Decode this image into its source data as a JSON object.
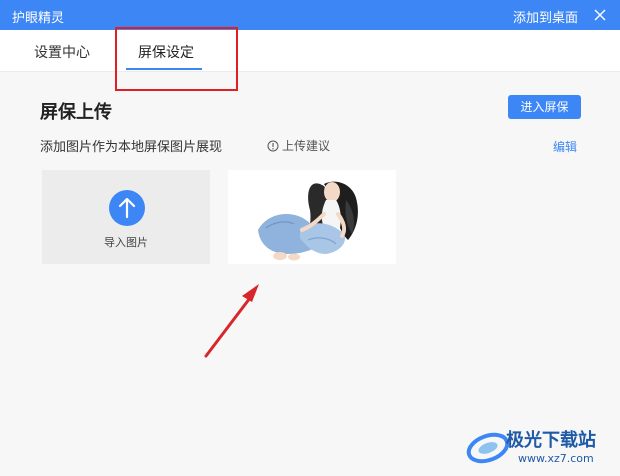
{
  "titlebar": {
    "app_title": "护眼精灵",
    "add_to_desktop": "添加到桌面",
    "close_icon": "close-icon"
  },
  "tabs": [
    {
      "label": "设置中心",
      "active": false
    },
    {
      "label": "屏保设定",
      "active": true
    }
  ],
  "section": {
    "title": "屏保上传",
    "enter_button": "进入屏保",
    "subtitle": "添加图片作为本地屏保图片展现",
    "hint": "上传建议",
    "edit_link": "编辑"
  },
  "upload_card": {
    "label": "导入图片",
    "icon": "upload-arrow-icon"
  },
  "image_card": {
    "icon": "illustration-girl-image"
  },
  "watermark": {
    "text": "极光下载站",
    "url": "www.xz7.com"
  },
  "colors": {
    "accent": "#3d86f6",
    "highlight": "#e02020",
    "arrow": "#d8262a"
  }
}
